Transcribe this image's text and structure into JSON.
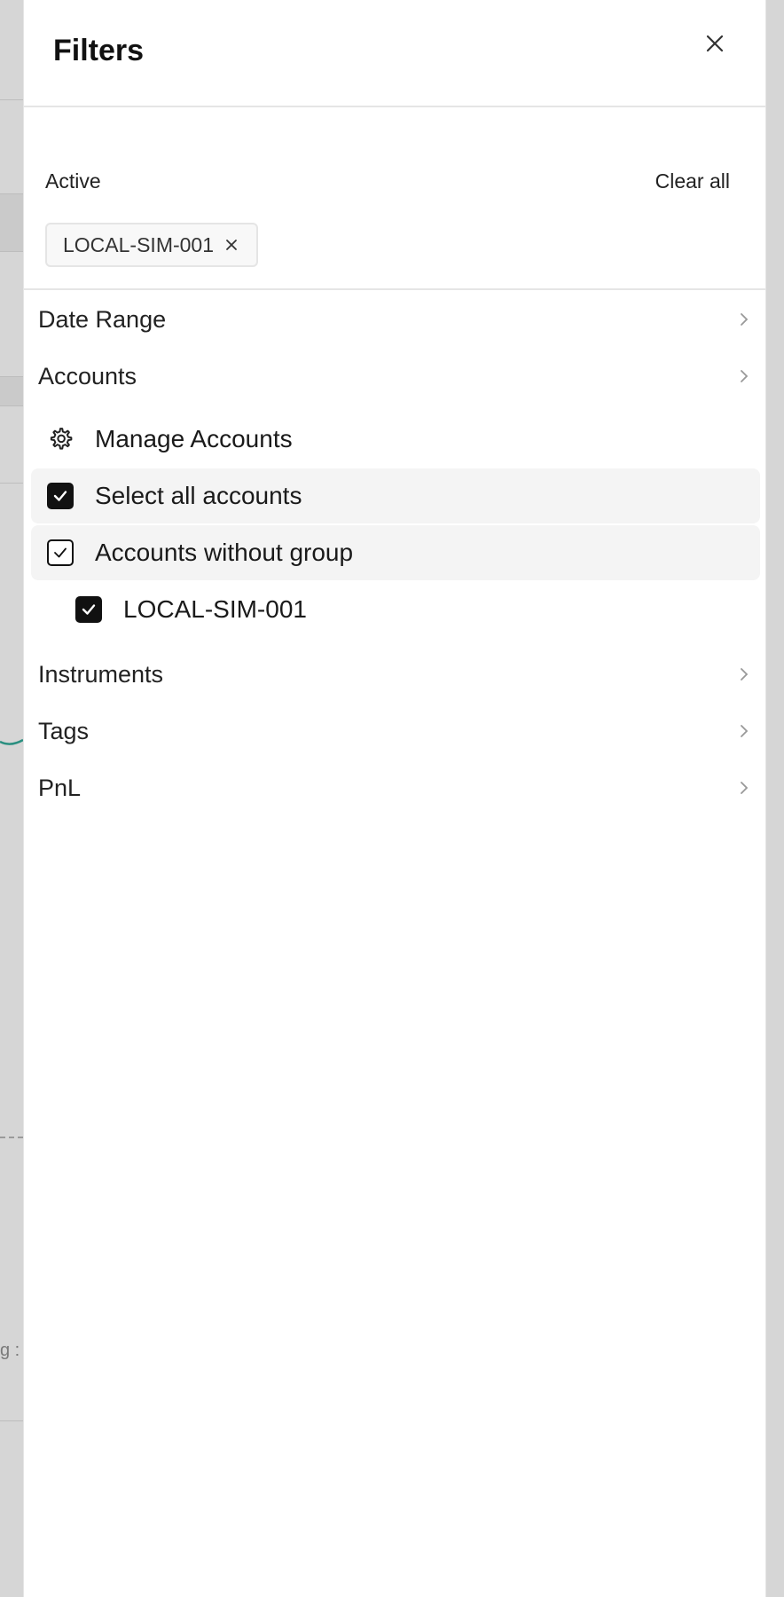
{
  "drawer": {
    "title": "Filters",
    "close_icon": "close-icon"
  },
  "active": {
    "label": "Active",
    "clear_all": "Clear all",
    "chips": [
      {
        "label": "LOCAL-SIM-001"
      }
    ]
  },
  "sections": {
    "date_range": "Date Range",
    "accounts": "Accounts",
    "instruments": "Instruments",
    "tags": "Tags",
    "pnl": "PnL"
  },
  "accounts_list": {
    "manage": "Manage Accounts",
    "select_all": "Select all accounts",
    "without_group": "Accounts without group",
    "account_1": "LOCAL-SIM-001"
  },
  "background": {
    "partial_text": "g :"
  },
  "colors": {
    "accent": "#111111",
    "highlight": "#f4f4f4",
    "border": "#e5e5e5",
    "chart_line": "#2a8f80"
  }
}
